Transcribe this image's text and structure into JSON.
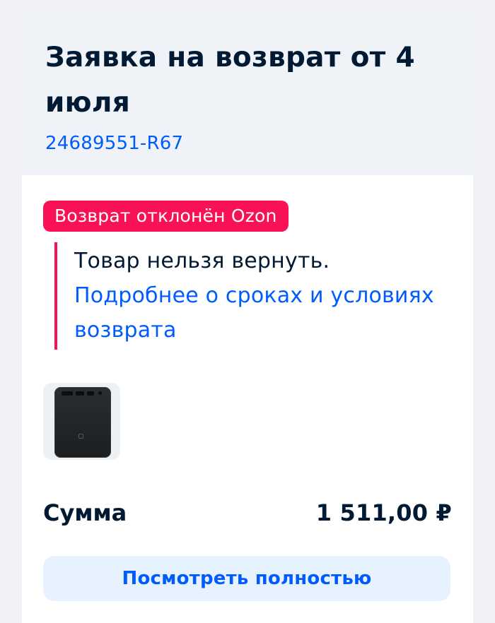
{
  "return_request": {
    "title": "Заявка на возврат от 4 июля",
    "order_id": "24689551-R67"
  },
  "status": {
    "badge": "Возврат отклонён Ozon",
    "reason": "Товар нельзя вернуть.",
    "link": "Подробнее о сроках и условиях возврата"
  },
  "product": {
    "image_icon": "power-bank-image"
  },
  "summary": {
    "label": "Сумма",
    "value": "1 511,00 ₽"
  },
  "actions": {
    "view_full": "Посмотреть полностью"
  },
  "colors": {
    "accent": "#005bff",
    "danger": "#f91155",
    "text": "#001a34"
  }
}
